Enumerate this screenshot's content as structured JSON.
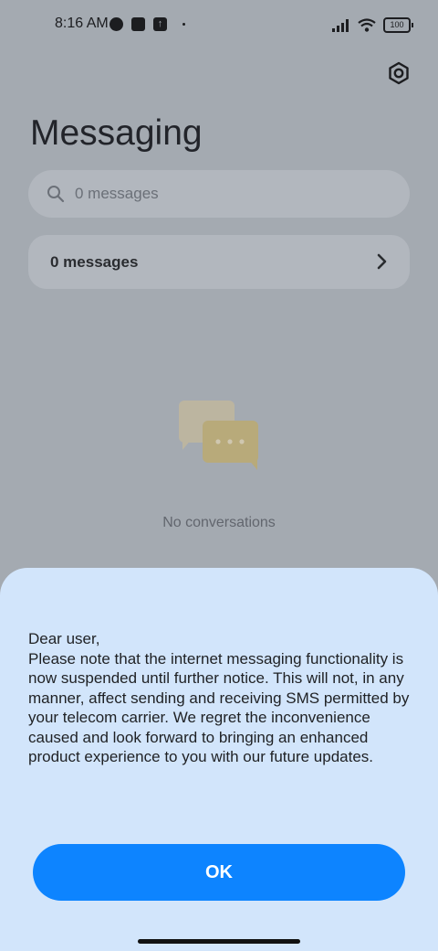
{
  "status_bar": {
    "time": "8:16 AM",
    "battery": "100"
  },
  "header": {
    "title": "Messaging",
    "settings_icon": "gear-icon"
  },
  "search": {
    "placeholder": "0 messages",
    "icon": "search-icon"
  },
  "messages_card": {
    "label": "0 messages",
    "icon": "chevron-right-icon"
  },
  "empty_state": {
    "icon": "chat-bubbles-icon",
    "text": "No conversations"
  },
  "dialog": {
    "message": "Dear user,\nPlease note that the internet messaging functionality is now suspended until further notice. This will not, in any manner, affect sending and receiving SMS permitted by your telecom carrier. We regret the inconvenience caused and look forward to bringing an enhanced product experience to you with our future updates.",
    "ok_label": "OK"
  },
  "colors": {
    "accent": "#0d84ff",
    "sheet": "#d2e5fb",
    "overlay": "#a4aab1"
  }
}
